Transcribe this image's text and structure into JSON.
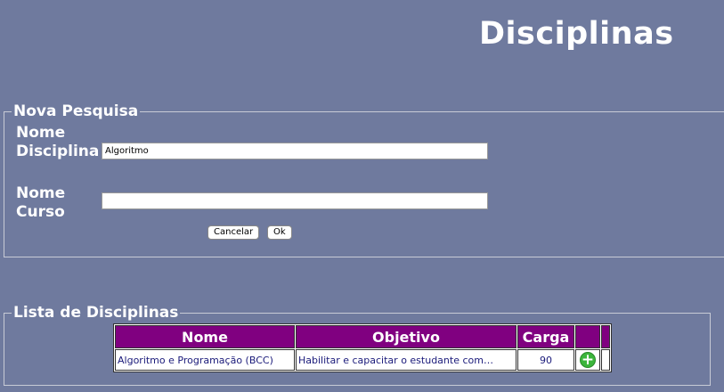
{
  "page": {
    "title": "Disciplinas"
  },
  "search": {
    "legend": "Nova Pesquisa",
    "nome_disciplina": {
      "label_line1": "Nome",
      "label_line2": "Disciplina",
      "value": "Algoritmo"
    },
    "nome_curso": {
      "label_line1": "Nome",
      "label_line2": "Curso",
      "value": ""
    },
    "cancel_label": "Cancelar",
    "ok_label": "Ok"
  },
  "list": {
    "legend": "Lista de Disciplinas",
    "headers": {
      "nome": "Nome",
      "objetivo": "Objetivo",
      "carga": "Carga"
    },
    "rows": [
      {
        "nome": "Algoritmo e Programação (BCC)",
        "objetivo": "Habilitar e capacitar o estudante com…",
        "carga": "90",
        "action_icon": "add-icon"
      }
    ]
  },
  "colors": {
    "background": "#6f7a9e",
    "header_bg": "#800080",
    "add_icon": "#3bb53b"
  }
}
